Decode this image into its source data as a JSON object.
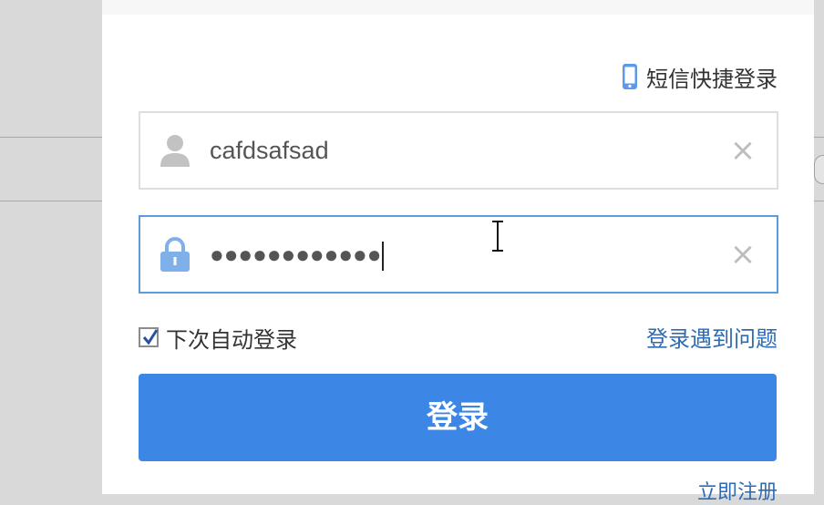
{
  "header": {
    "sms_login_label": "短信快捷登录"
  },
  "username": {
    "value": "cafdsafsad",
    "clear_icon": "×"
  },
  "password": {
    "masked_value": "●●●●●●●●●●●●",
    "clear_icon": "×"
  },
  "remember": {
    "label": "下次自动登录",
    "checked": true
  },
  "links": {
    "trouble": "登录遇到问题",
    "register": "立即注册"
  },
  "login_button": {
    "label": "登录"
  },
  "colors": {
    "accent": "#3c87e5",
    "link": "#2e6bb3",
    "focus_border": "#5b9be0"
  }
}
